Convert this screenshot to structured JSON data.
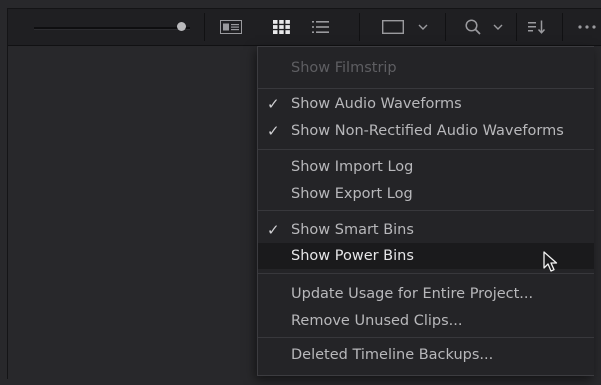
{
  "toolbar": {
    "icons": [
      "metadata-view-icon",
      "thumbnail-view-icon",
      "list-view-icon",
      "clip-size-icon",
      "chevron-down-icon",
      "search-icon",
      "chevron-down-icon",
      "sort-icon",
      "more-options-icon"
    ],
    "zoom_level": 0.95,
    "active_icon": "thumbnail-view-icon"
  },
  "menu": {
    "items": [
      {
        "label": "Show Filmstrip",
        "checked": false,
        "enabled": false
      },
      {
        "label": "Show Audio Waveforms",
        "checked": true,
        "enabled": true
      },
      {
        "label": "Show Non-Rectified Audio Waveforms",
        "checked": true,
        "enabled": true
      },
      {
        "label": "Show Import Log",
        "checked": false,
        "enabled": true
      },
      {
        "label": "Show Export Log",
        "checked": false,
        "enabled": true
      },
      {
        "label": "Show Smart Bins",
        "checked": true,
        "enabled": true
      },
      {
        "label": "Show Power Bins",
        "checked": false,
        "enabled": true,
        "hovered": true
      },
      {
        "label": "Update Usage for Entire Project...",
        "checked": false,
        "enabled": true
      },
      {
        "label": "Remove Unused Clips...",
        "checked": false,
        "enabled": true
      },
      {
        "label": "Deleted Timeline Backups...",
        "checked": false,
        "enabled": true
      }
    ],
    "check_glyph": "✓"
  },
  "colors": {
    "panel_bg": "#28282b",
    "toolbar_bg": "#1f1f22",
    "menu_bg": "#242427",
    "menu_hover_bg": "#1a1a1c",
    "text": "#b8b8bb",
    "text_disabled": "#5e5e62",
    "icon": "#9a9a9e",
    "icon_active": "#e8e8ea"
  }
}
